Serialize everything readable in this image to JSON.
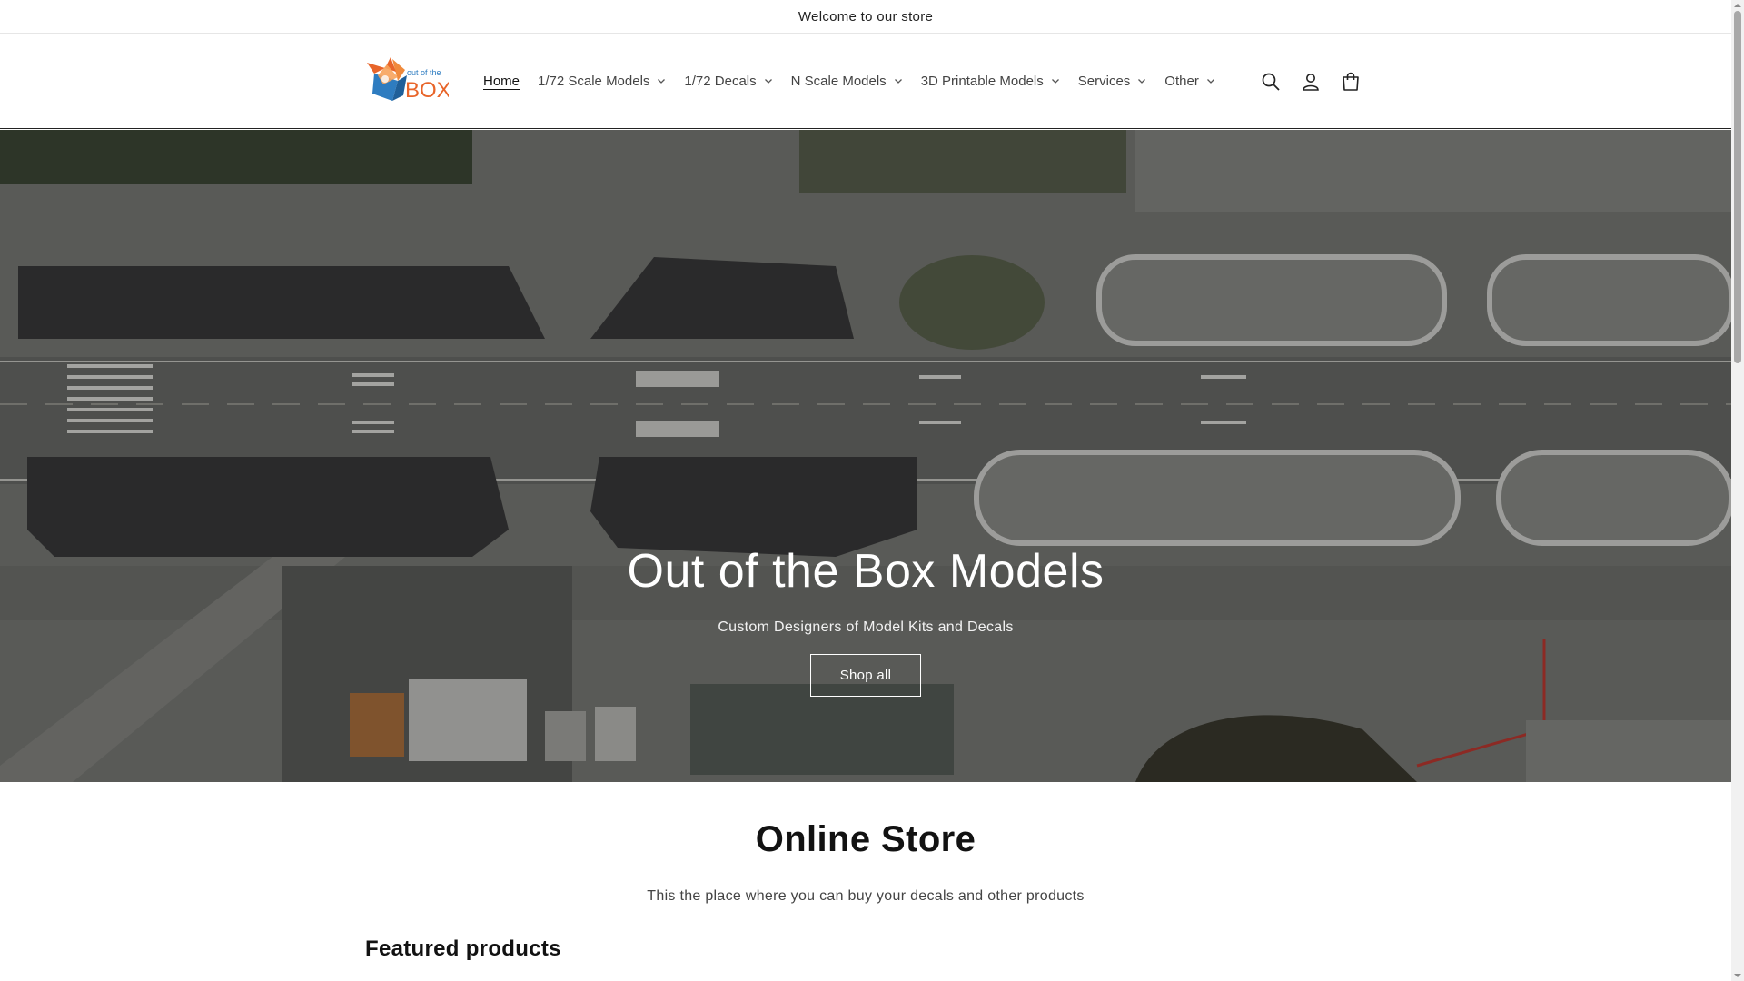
{
  "announcement": "Welcome to our store",
  "brand": {
    "logo_text_top": "out of the",
    "logo_text_main": "BOX"
  },
  "nav": {
    "items": [
      {
        "label": "Home",
        "active": true,
        "dropdown": false
      },
      {
        "label": "1/72 Scale Models",
        "active": false,
        "dropdown": true
      },
      {
        "label": "1/72 Decals",
        "active": false,
        "dropdown": true
      },
      {
        "label": "N Scale Models",
        "active": false,
        "dropdown": true
      },
      {
        "label": "3D Printable Models",
        "active": false,
        "dropdown": true
      },
      {
        "label": "Services",
        "active": false,
        "dropdown": true
      },
      {
        "label": "Other",
        "active": false,
        "dropdown": true
      }
    ]
  },
  "header_icons": [
    "search-icon",
    "account-icon",
    "cart-icon"
  ],
  "hero": {
    "title": "Out of the Box Models",
    "subtitle": "Custom Designers of Model Kits and Decals",
    "button_label": "Shop all"
  },
  "section": {
    "title": "Online Store",
    "description": "This the place where you can buy your decals and other products"
  },
  "featured_heading": "Featured products",
  "colors": {
    "logo_orange": "#e8652a",
    "logo_blue": "#2e7cc0",
    "text": "#121212"
  }
}
